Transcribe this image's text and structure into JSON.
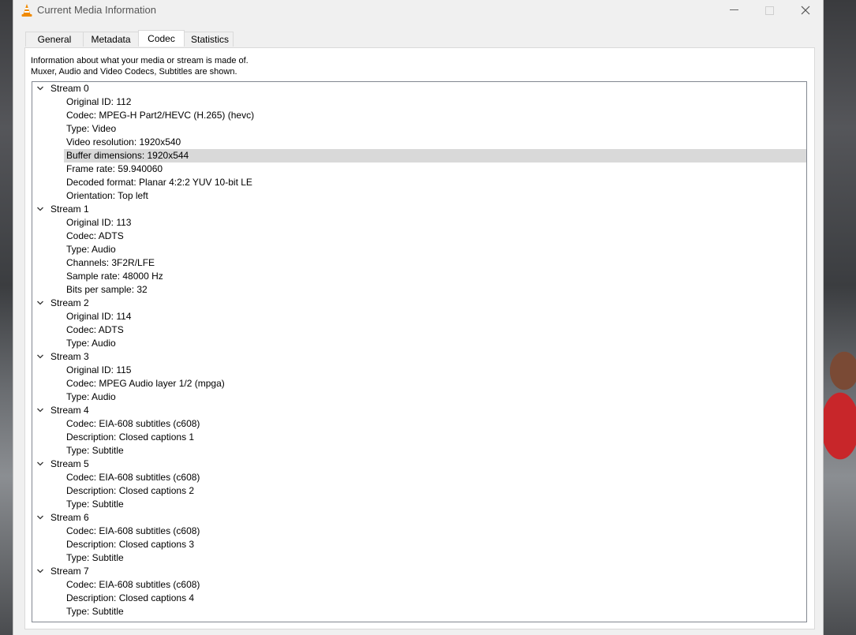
{
  "window": {
    "title": "Current Media Information",
    "controls": {
      "minimize": "—",
      "close": "✕"
    }
  },
  "tabs": [
    {
      "label": "General"
    },
    {
      "label": "Metadata"
    },
    {
      "label": "Codec",
      "active": true
    },
    {
      "label": "Statistics"
    }
  ],
  "codec": {
    "description_line1": "Information about what your media or stream is made of.",
    "description_line2": "Muxer, Audio and Video Codecs, Subtitles are shown.",
    "selected_row": "Buffer dimensions: 1920x544",
    "streams": [
      {
        "name": "Stream 0",
        "props": [
          "Original ID: 112",
          "Codec: MPEG-H Part2/HEVC (H.265) (hevc)",
          "Type: Video",
          "Video resolution: 1920x540",
          "Buffer dimensions: 1920x544",
          "Frame rate: 59.940060",
          "Decoded format: Planar 4:2:2 YUV 10-bit LE",
          "Orientation: Top left"
        ]
      },
      {
        "name": "Stream 1",
        "props": [
          "Original ID: 113",
          "Codec: ADTS",
          "Type: Audio",
          "Channels: 3F2R/LFE",
          "Sample rate: 48000 Hz",
          "Bits per sample: 32"
        ]
      },
      {
        "name": "Stream 2",
        "props": [
          "Original ID: 114",
          "Codec: ADTS",
          "Type: Audio"
        ]
      },
      {
        "name": "Stream 3",
        "props": [
          "Original ID: 115",
          "Codec: MPEG Audio layer 1/2 (mpga)",
          "Type: Audio"
        ]
      },
      {
        "name": "Stream 4",
        "props": [
          "Codec: EIA-608 subtitles (c608)",
          "Description: Closed captions 1",
          "Type: Subtitle"
        ]
      },
      {
        "name": "Stream 5",
        "props": [
          "Codec: EIA-608 subtitles (c608)",
          "Description: Closed captions 2",
          "Type: Subtitle"
        ]
      },
      {
        "name": "Stream 6",
        "props": [
          "Codec: EIA-608 subtitles (c608)",
          "Description: Closed captions 3",
          "Type: Subtitle"
        ]
      },
      {
        "name": "Stream 7",
        "props": [
          "Codec: EIA-608 subtitles (c608)",
          "Description: Closed captions 4",
          "Type: Subtitle"
        ]
      }
    ]
  },
  "colors": {
    "window_bg": "#f0f0f0",
    "selection": "#d9d9d9",
    "vlc_orange": "#f08a00"
  },
  "icons": {
    "app": "vlc-cone-icon",
    "expand": "chevron-down-icon"
  }
}
